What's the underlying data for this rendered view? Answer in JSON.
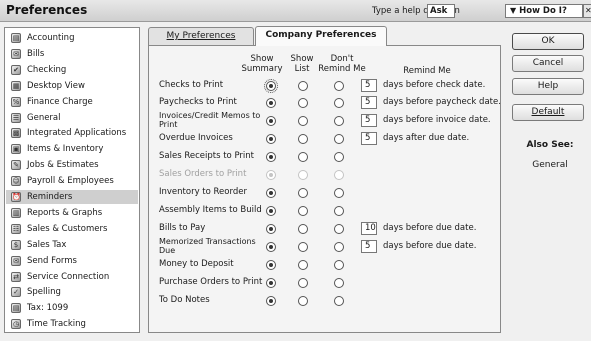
{
  "window": {
    "title": "Preferences",
    "help_question_label": "Type a help question",
    "help_input_value": "Ask",
    "how_do_i_label": "How Do I?"
  },
  "sidebar": {
    "items": [
      {
        "label": "Accounting",
        "icon": "accounting-icon"
      },
      {
        "label": "Bills",
        "icon": "bills-icon"
      },
      {
        "label": "Checking",
        "icon": "checking-icon"
      },
      {
        "label": "Desktop View",
        "icon": "desktop-view-icon"
      },
      {
        "label": "Finance Charge",
        "icon": "finance-charge-icon"
      },
      {
        "label": "General",
        "icon": "general-icon"
      },
      {
        "label": "Integrated Applications",
        "icon": "integrated-applications-icon"
      },
      {
        "label": "Items & Inventory",
        "icon": "items-inventory-icon"
      },
      {
        "label": "Jobs & Estimates",
        "icon": "jobs-estimates-icon"
      },
      {
        "label": "Payroll & Employees",
        "icon": "payroll-employees-icon"
      },
      {
        "label": "Reminders",
        "icon": "reminders-icon",
        "selected": true
      },
      {
        "label": "Reports & Graphs",
        "icon": "reports-graphs-icon"
      },
      {
        "label": "Sales & Customers",
        "icon": "sales-customers-icon"
      },
      {
        "label": "Sales Tax",
        "icon": "sales-tax-icon"
      },
      {
        "label": "Send Forms",
        "icon": "send-forms-icon"
      },
      {
        "label": "Service Connection",
        "icon": "service-connection-icon"
      },
      {
        "label": "Spelling",
        "icon": "spelling-icon"
      },
      {
        "label": "Tax: 1099",
        "icon": "tax-1099-icon"
      },
      {
        "label": "Time Tracking",
        "icon": "time-tracking-icon"
      }
    ]
  },
  "tabs": {
    "my_preferences": "My Preferences",
    "company_preferences": "Company Preferences",
    "active": "company_preferences"
  },
  "columns": {
    "show_summary": "Show Summary",
    "show_list": "Show List",
    "dont_remind": "Don't Remind Me",
    "remind_me": "Remind Me"
  },
  "reminders": [
    {
      "label": "Checks to Print",
      "selected": "summary",
      "days": "5",
      "text": "days before check date."
    },
    {
      "label": "Paychecks to Print",
      "selected": "summary",
      "days": "5",
      "text": "days before paycheck date."
    },
    {
      "label": "Invoices/Credit Memos to Print",
      "selected": "summary",
      "days": "5",
      "text": "days before invoice date."
    },
    {
      "label": "Overdue Invoices",
      "selected": "summary",
      "days": "5",
      "text": "days after due date."
    },
    {
      "label": "Sales Receipts to Print",
      "selected": "summary"
    },
    {
      "label": "Sales Orders to Print",
      "selected": "summary",
      "disabled": true
    },
    {
      "label": "Inventory to Reorder",
      "selected": "summary"
    },
    {
      "label": "Assembly Items to Build",
      "selected": "summary"
    },
    {
      "label": "Bills to Pay",
      "selected": "summary",
      "days": "10",
      "text": "days before due date."
    },
    {
      "label": "Memorized Transactions Due",
      "selected": "summary",
      "days": "5",
      "text": "days before due date."
    },
    {
      "label": "Money to Deposit",
      "selected": "summary"
    },
    {
      "label": "Purchase Orders to Print",
      "selected": "summary"
    },
    {
      "label": "To Do Notes",
      "selected": "summary"
    }
  ],
  "buttons": {
    "ok": "OK",
    "cancel": "Cancel",
    "help": "Help",
    "default": "Default"
  },
  "also_see": {
    "heading": "Also See:",
    "link": "General"
  }
}
